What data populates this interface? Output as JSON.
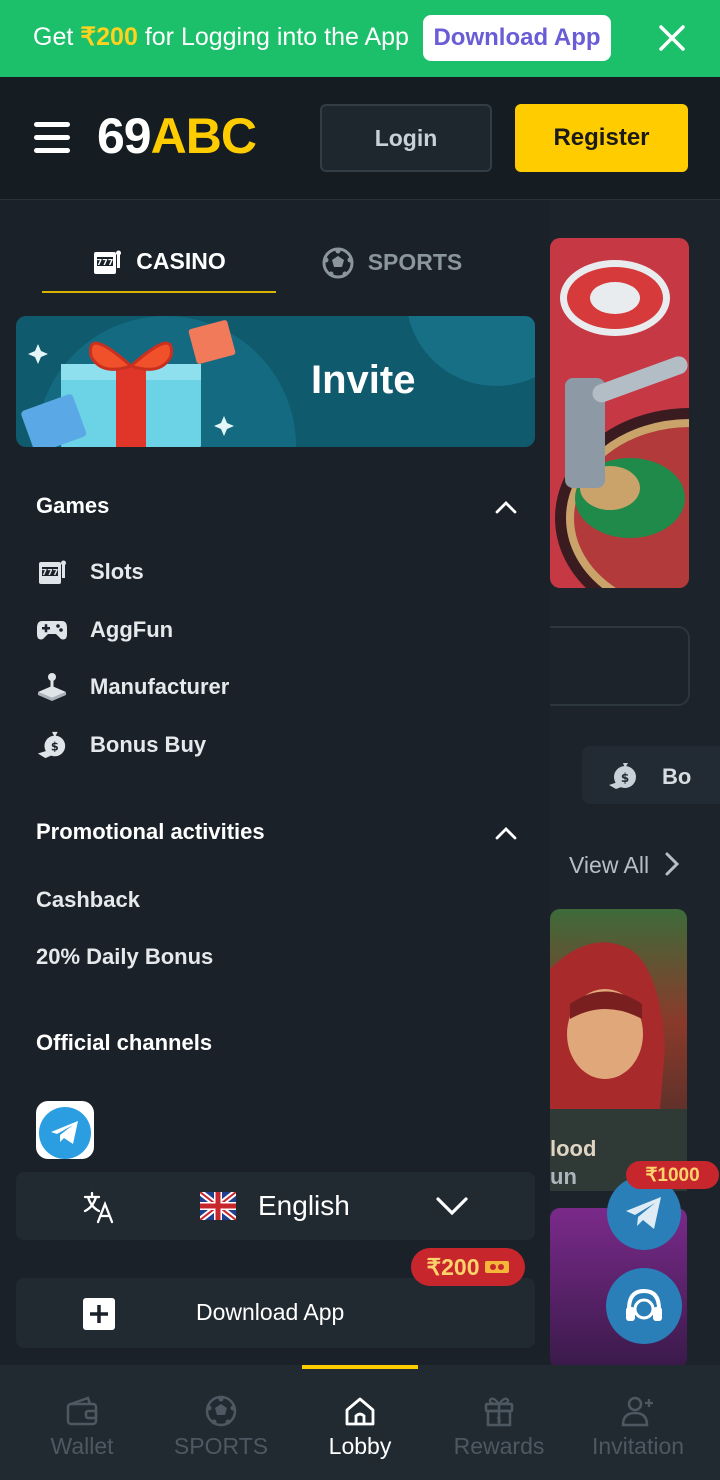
{
  "promo_banner": {
    "text_prefix": "Get ",
    "amount": "₹200",
    "text_suffix": " for Logging into the App",
    "download_label": "Download App",
    "bg_color": "#1cbf6a"
  },
  "header": {
    "logo_number": "69",
    "logo_letters": "ABC",
    "login_label": "Login",
    "register_label": "Register",
    "accent_color": "#ffcc00"
  },
  "drawer": {
    "tabs": [
      {
        "label": "CASINO",
        "icon": "slot-machine-icon",
        "active": true
      },
      {
        "label": "SPORTS",
        "icon": "soccer-ball-icon",
        "active": false
      }
    ],
    "invite_label": "Invite",
    "games_section": {
      "title": "Games",
      "items": [
        {
          "label": "Slots",
          "icon": "slot-machine-icon"
        },
        {
          "label": "AggFun",
          "icon": "gamepad-icon"
        },
        {
          "label": "Manufacturer",
          "icon": "joystick-icon"
        },
        {
          "label": "Bonus Buy",
          "icon": "money-bag-icon"
        }
      ]
    },
    "promotions_section": {
      "title": "Promotional activities",
      "items": [
        {
          "label": "Cashback"
        },
        {
          "label": "20% Daily Bonus"
        }
      ]
    },
    "channels_section": {
      "title": "Official channels",
      "channels": [
        {
          "icon": "telegram-icon"
        }
      ]
    },
    "language": {
      "icon": "translate-icon",
      "flag": "uk-flag-icon",
      "current": "English"
    },
    "download": {
      "label": "Download App",
      "badge_amount": "₹200"
    }
  },
  "background_page": {
    "chip_label": "Bo",
    "view_all": "View All",
    "game_title_line1": "lood",
    "game_title_line2": "un"
  },
  "floating": {
    "telegram_badge": "₹1000"
  },
  "bottom_nav": {
    "items": [
      {
        "label": "Wallet",
        "icon": "wallet-icon",
        "active": false
      },
      {
        "label": "SPORTS",
        "icon": "soccer-ball-icon",
        "active": false
      },
      {
        "label": "Lobby",
        "icon": "home-icon",
        "active": true
      },
      {
        "label": "Rewards",
        "icon": "gift-icon",
        "active": false
      },
      {
        "label": "Invitation",
        "icon": "add-user-icon",
        "active": false
      }
    ]
  }
}
